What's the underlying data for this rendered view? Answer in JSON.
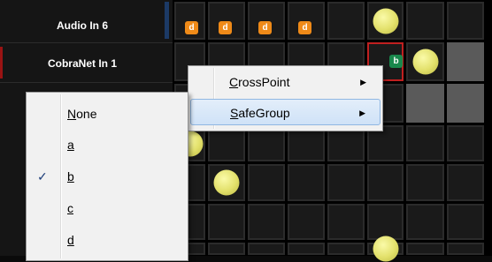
{
  "row_labels": [
    "Audio In 6",
    "CobraNet In 1"
  ],
  "badge_grid": [
    {
      "row": 0,
      "col": 0,
      "letter": "d",
      "color": "#ef8a18"
    },
    {
      "row": 0,
      "col": 1,
      "letter": "d",
      "color": "#ef8a18"
    },
    {
      "row": 0,
      "col": 2,
      "letter": "d",
      "color": "#ef8a18"
    },
    {
      "row": 0,
      "col": 3,
      "letter": "d",
      "color": "#ef8a18"
    },
    {
      "row": 1,
      "col": 5,
      "letter": "b",
      "color": "#19884c"
    }
  ],
  "context_menu": {
    "items": [
      {
        "label": "CrossPoint",
        "accel": "C",
        "has_submenu": true
      },
      {
        "label": "SafeGroup",
        "accel": "S",
        "has_submenu": true,
        "highlighted": true
      }
    ]
  },
  "submenu": {
    "items": [
      {
        "label": "None",
        "checked": false
      },
      {
        "label": "a",
        "checked": false
      },
      {
        "label": "b",
        "checked": true
      },
      {
        "label": "c",
        "checked": false
      },
      {
        "label": "d",
        "checked": false
      }
    ]
  },
  "icons": {
    "submenu_arrow": "▶",
    "check": "✓"
  },
  "colors": {
    "dot": "#e2e06a",
    "safegroup_d": "#ef8a18",
    "safegroup_b": "#19884c",
    "selection_border": "#c02020"
  }
}
